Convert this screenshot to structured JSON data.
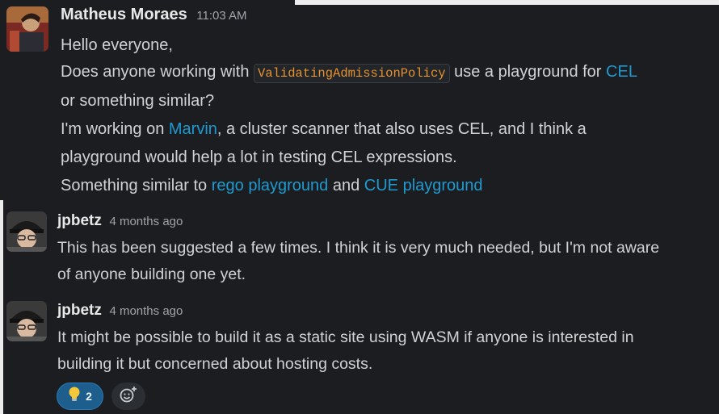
{
  "messages": [
    {
      "author": "Matheus Moraes",
      "time": "11:03 AM",
      "lines": {
        "l1": "Hello everyone,",
        "l2_a": "Does anyone working with ",
        "l2_code": "ValidatingAdmissionPolicy",
        "l2_b": " use a playground for ",
        "l2_link": "CEL",
        "l3": "or something similar?",
        "l4_a": "I'm working on ",
        "l4_link": "Marvin",
        "l4_b": ", a cluster scanner that also uses CEL, and I think a",
        "l5": "playground would help a lot in testing CEL expressions.",
        "l6_a": "Something similar to ",
        "l6_link1": "rego playground",
        "l6_b": " and ",
        "l6_link2": "CUE playground"
      }
    },
    {
      "author": "jpbetz",
      "time": "4 months ago",
      "lines": {
        "l1": "This has been suggested a few times.  I think it is very much needed, but I'm not aware",
        "l2": "of anyone building one yet."
      }
    },
    {
      "author": "jpbetz",
      "time": "4 months ago",
      "lines": {
        "l1": "It might be possible to build it as a static site using WASM if anyone is interested in",
        "l2": "building it but concerned about hosting costs."
      }
    }
  ],
  "reactions": [
    {
      "emoji": "lightbulb-icon",
      "count": "2"
    }
  ],
  "add_reaction_icon": "add-reaction-icon",
  "colors": {
    "link": "#1d9bd1",
    "code": "#e8912d",
    "reaction_bg": "#1d5e8c"
  }
}
